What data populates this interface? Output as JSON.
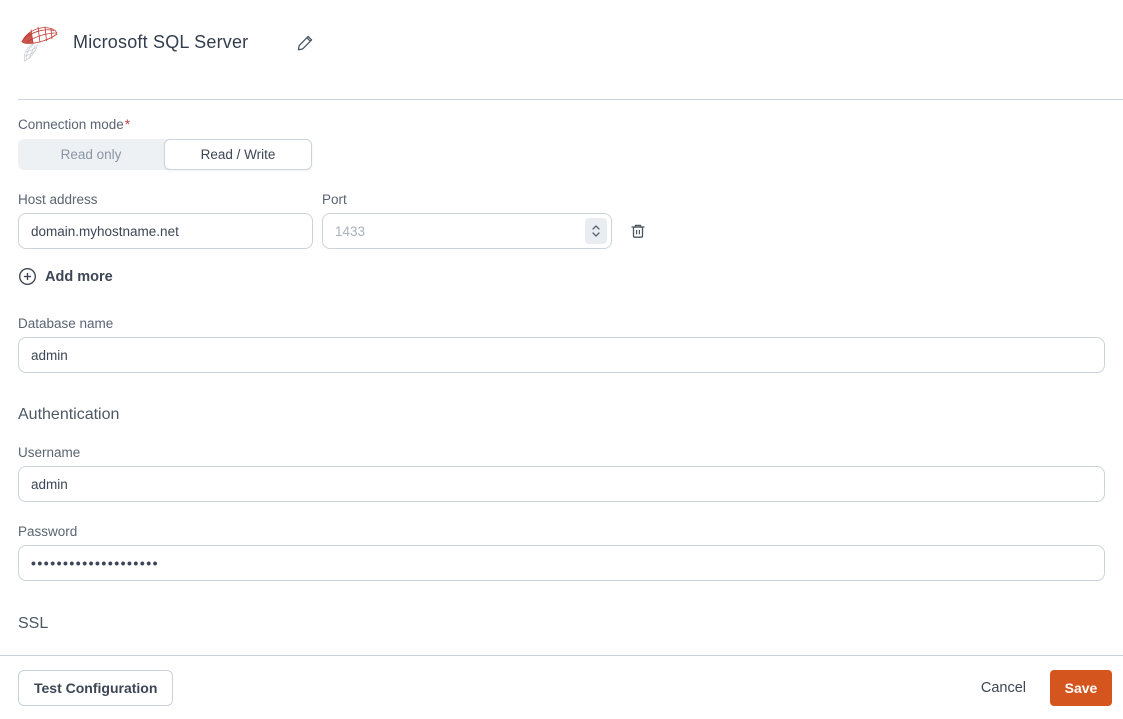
{
  "header": {
    "title": "Microsoft SQL Server"
  },
  "connection_mode": {
    "label": "Connection mode",
    "required_marker": "*",
    "options": [
      {
        "label": "Read only",
        "selected": false
      },
      {
        "label": "Read / Write",
        "selected": true
      }
    ]
  },
  "host": {
    "label": "Host address",
    "value": "domain.myhostname.net"
  },
  "port": {
    "label": "Port",
    "placeholder": "1433"
  },
  "add_more": {
    "label": "Add more"
  },
  "database": {
    "label": "Database name",
    "value": "admin"
  },
  "auth": {
    "heading": "Authentication",
    "username_label": "Username",
    "username_value": "admin",
    "password_label": "Password",
    "password_masked_value": "••••••••••••••••••••"
  },
  "ssl": {
    "heading": "SSL"
  },
  "footer": {
    "test_label": "Test Configuration",
    "cancel_label": "Cancel",
    "save_label": "Save"
  },
  "colors": {
    "accent_orange": "#d4551e",
    "logo_red": "#c13a30",
    "required_red": "#d03a3a",
    "divider_gray": "#ccd3dc"
  }
}
